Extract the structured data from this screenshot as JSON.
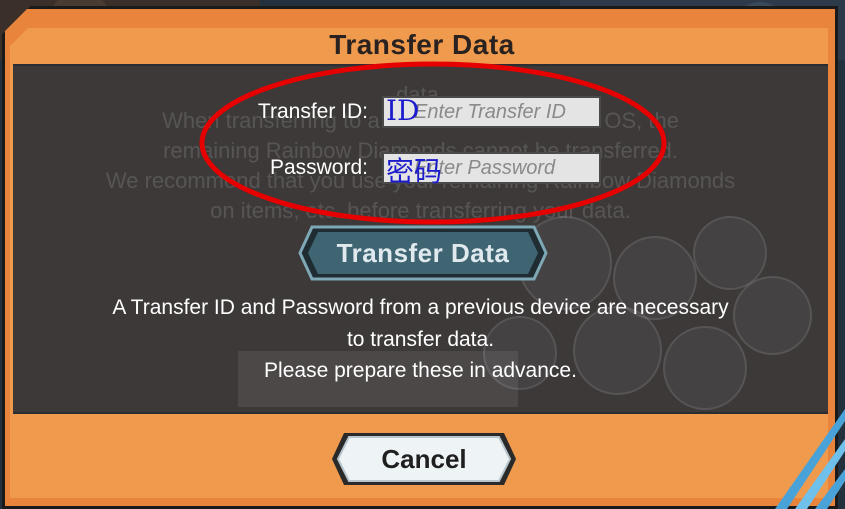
{
  "dialog": {
    "title": "Transfer Data",
    "background_text": [
      "data.",
      "When transferring to a device with a different OS, the",
      "remaining Rainbow Diamonds cannot be transferred.",
      "We recommend that you use your remaining Rainbow Diamonds",
      "on items, etc. before transferring your data."
    ]
  },
  "form": {
    "transfer_id": {
      "label": "Transfer ID:",
      "placeholder": "Enter Transfer ID",
      "overlay_annotation": "ID"
    },
    "password": {
      "label": "Password:",
      "placeholder": "Enter Password",
      "overlay_annotation": "密码"
    }
  },
  "buttons": {
    "transfer_label": "Transfer Data",
    "cancel_label": "Cancel"
  },
  "info": {
    "line1": "A Transfer ID and Password from a previous device are necessary",
    "line2": "to transfer data.",
    "line3": "Please prepare these in advance."
  },
  "colors": {
    "frame_orange": "#e8843c",
    "panel_dark": "#2e3237",
    "annotation_red": "#e60000",
    "annotation_blue": "#1c1ccc"
  }
}
